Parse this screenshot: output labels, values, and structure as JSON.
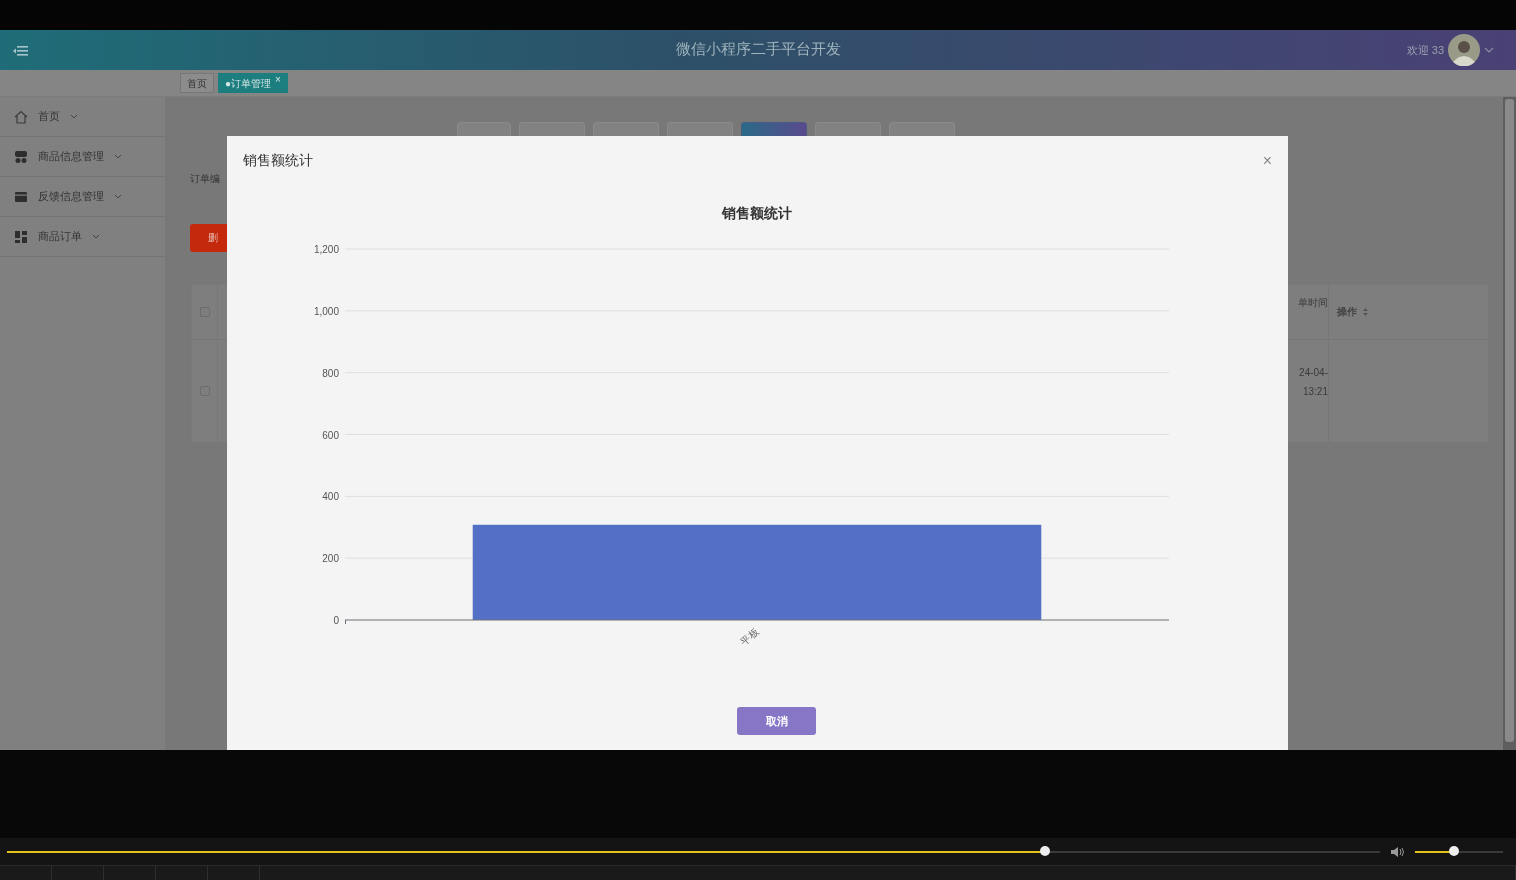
{
  "header": {
    "title": "微信小程序二手平台开发",
    "welcome": "欢迎 33"
  },
  "breadcrumbs": [
    {
      "label": "首页",
      "selected": false
    },
    {
      "label": "●订单管理",
      "selected": true,
      "close": "×"
    }
  ],
  "sidebar": {
    "items": [
      {
        "label": "首页"
      },
      {
        "label": "商品信息管理"
      },
      {
        "label": "反馈信息管理"
      },
      {
        "label": "商品订单"
      }
    ]
  },
  "status_tabs": [
    {
      "selected": false
    },
    {
      "selected": false
    },
    {
      "selected": false
    },
    {
      "selected": false
    },
    {
      "selected": true
    },
    {
      "selected": false
    },
    {
      "selected": false
    }
  ],
  "search": {
    "label": "订单编"
  },
  "delete_button": "删",
  "table": {
    "header_checked": false,
    "columns": [
      "单时间",
      "操作"
    ],
    "rows": [
      {
        "checked": false,
        "order_time": [
          "24-04-",
          "13:21"
        ]
      }
    ]
  },
  "modal": {
    "title": "销售额统计",
    "close": "×",
    "cancel": "取消",
    "chart_data": {
      "type": "bar",
      "grid": true,
      "title": "销售额统计",
      "categories": [
        "平板"
      ],
      "values": [
        308
      ],
      "ylim": [
        0,
        1200
      ],
      "yticks": [
        0,
        200,
        400,
        600,
        800,
        {
          "value": 1000,
          "label": "1,000"
        },
        {
          "value": 1200,
          "label": "1,200"
        }
      ]
    }
  },
  "player": {
    "progress": {
      "level": 0.756
    },
    "volume": {
      "level": 0.44
    }
  }
}
